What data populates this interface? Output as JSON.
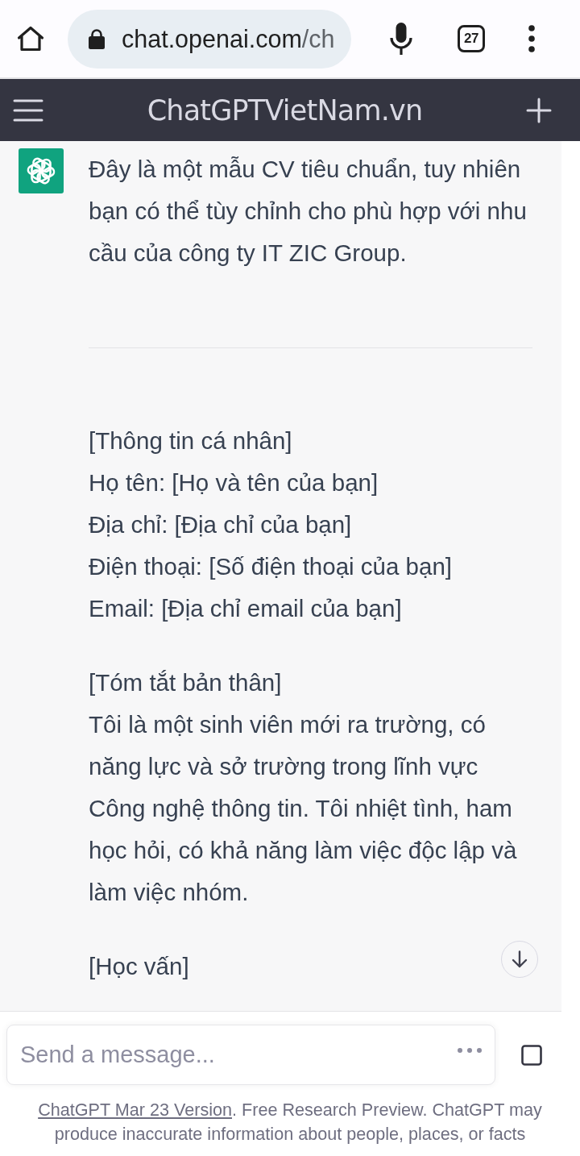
{
  "browser_bar": {
    "address": {
      "host": "chat.openai.com",
      "path": "/ch"
    },
    "tab_count": "27"
  },
  "header": {
    "title": "ChatGPTVietNam.vn"
  },
  "chat": {
    "messages": [
      {
        "blocks": [
          {
            "kind": "paragraph",
            "text": "Đây là một mẫu CV tiêu chuẩn, tuy nhiên bạn có thể tùy chỉnh cho phù hợp với nhu cầu của công ty IT ZIC Group."
          },
          {
            "kind": "rule"
          },
          {
            "kind": "lines",
            "lines": [
              "[Thông tin cá nhân]",
              "Họ tên: [Họ và tên của bạn]",
              "Địa chỉ: [Địa chỉ của bạn]",
              "Điện thoại: [Số điện thoại của bạn]",
              "Email: [Địa chỉ email của bạn]"
            ]
          },
          {
            "kind": "lines",
            "lines": [
              "[Tóm tắt bản thân]",
              "Tôi là một sinh viên mới ra trường, có năng lực và sở trường trong lĩnh vực Công nghệ thông tin. Tôi nhiệt tình, ham học hỏi, có khả năng làm việc độc lập và làm việc nhóm."
            ]
          },
          {
            "kind": "lines",
            "lines": [
              "[Học vấn]"
            ]
          }
        ]
      }
    ]
  },
  "composer": {
    "placeholder": "Send a message...",
    "generating": true
  },
  "footer": {
    "link": "ChatGPT Mar 23 Version",
    "text": ". Free Research Preview. ChatGPT may produce inaccurate information about people, places, or facts"
  }
}
